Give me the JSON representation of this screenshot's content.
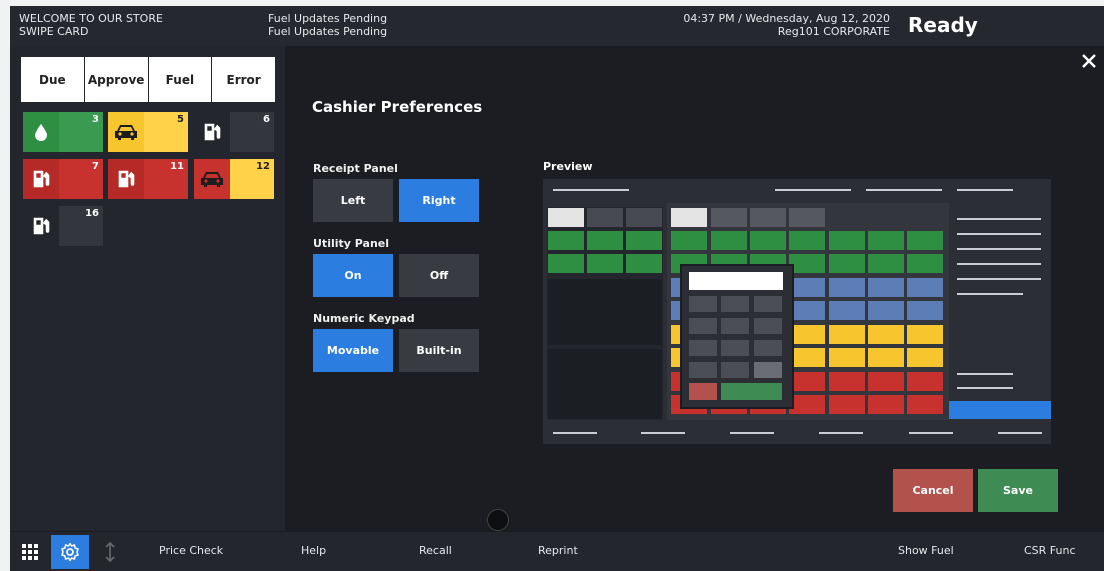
{
  "header": {
    "store_line1": "WELCOME TO OUR STORE",
    "store_line2": "SWIPE CARD",
    "fuel_line1": "Fuel Updates Pending",
    "fuel_line2": "Fuel Updates Pending",
    "datetime": "04:37 PM / Wednesday, Aug 12, 2020",
    "register": "Reg101  CORPORATE",
    "status": "Ready"
  },
  "fuel_tabs": [
    "Due",
    "Approve",
    "Fuel",
    "Error"
  ],
  "pumps": [
    {
      "number": "3",
      "icon": "fuel-drop-icon",
      "state": "green"
    },
    {
      "number": "5",
      "icon": "car-icon",
      "state": "yellow"
    },
    {
      "number": "6",
      "icon": "fuel-pump-icon",
      "state": "idle"
    },
    {
      "number": "7",
      "icon": "fuel-pump-icon",
      "state": "red"
    },
    {
      "number": "11",
      "icon": "fuel-pump-icon",
      "state": "red"
    },
    {
      "number": "12",
      "icon": "car-icon",
      "state": "red-yellow"
    },
    {
      "number": "16",
      "icon": "fuel-pump-icon",
      "state": "idle"
    }
  ],
  "preferences": {
    "title": "Cashier Preferences",
    "receipt_panel": {
      "label": "Receipt Panel",
      "options": [
        "Left",
        "Right"
      ],
      "selected": "Right"
    },
    "utility_panel": {
      "label": "Utility Panel",
      "options": [
        "On",
        "Off"
      ],
      "selected": "On"
    },
    "numeric_keypad": {
      "label": "Numeric Keypad",
      "options": [
        "Movable",
        "Built-in"
      ],
      "selected": "Movable"
    },
    "preview_label": "Preview",
    "cancel_label": "Cancel",
    "save_label": "Save"
  },
  "bottom_bar": {
    "items": [
      "Price Check",
      "Help",
      "Recall",
      "Reprint",
      "Show Fuel",
      "CSR Func"
    ]
  },
  "colors": {
    "accent_blue": "#2b7de0",
    "green": "#3a9a4f",
    "yellow": "#ffd24a",
    "red": "#c8322e",
    "cancel": "#b3524c",
    "save": "#3f8b54"
  }
}
